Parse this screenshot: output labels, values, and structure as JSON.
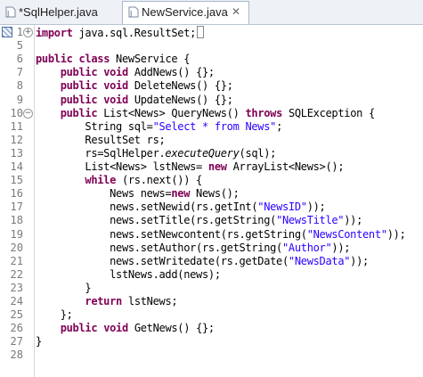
{
  "tabs": [
    {
      "label": "*SqlHelper.java",
      "active": false,
      "icon": "java-file-icon"
    },
    {
      "label": "NewService.java",
      "active": true,
      "icon": "java-file-icon",
      "close": "✕"
    }
  ],
  "colors": {
    "keyword": "#7f0055",
    "string": "#2a00ff",
    "field": "#0000c0",
    "line_number": "#7a7a7a"
  },
  "editor": {
    "lines": [
      {
        "n": "1",
        "tokens": [
          {
            "t": "import",
            "c": "kw"
          },
          {
            "t": " java.sql.ResultSet;"
          }
        ],
        "fold": "⊕"
      },
      {
        "n": "5",
        "tokens": []
      },
      {
        "n": "6",
        "tokens": [
          {
            "t": "public",
            "c": "kw"
          },
          {
            "t": " "
          },
          {
            "t": "class",
            "c": "kw"
          },
          {
            "t": " NewService {"
          }
        ]
      },
      {
        "n": "7",
        "tokens": [
          {
            "t": "    "
          },
          {
            "t": "public",
            "c": "kw"
          },
          {
            "t": " "
          },
          {
            "t": "void",
            "c": "kw"
          },
          {
            "t": " AddNews() {};"
          }
        ]
      },
      {
        "n": "8",
        "tokens": [
          {
            "t": "    "
          },
          {
            "t": "public",
            "c": "kw"
          },
          {
            "t": " "
          },
          {
            "t": "void",
            "c": "kw"
          },
          {
            "t": " DeleteNews() {};"
          }
        ]
      },
      {
        "n": "9",
        "tokens": [
          {
            "t": "    "
          },
          {
            "t": "public",
            "c": "kw"
          },
          {
            "t": " "
          },
          {
            "t": "void",
            "c": "kw"
          },
          {
            "t": " UpdateNews() {};"
          }
        ]
      },
      {
        "n": "10",
        "tokens": [
          {
            "t": "    "
          },
          {
            "t": "public",
            "c": "kw"
          },
          {
            "t": " List<News> QueryNews() "
          },
          {
            "t": "throws",
            "c": "kw"
          },
          {
            "t": " SQLException {"
          }
        ],
        "fold": "⊖"
      },
      {
        "n": "11",
        "tokens": [
          {
            "t": "        String sql="
          },
          {
            "t": "\"Select * from News\"",
            "c": "str"
          },
          {
            "t": ";"
          }
        ]
      },
      {
        "n": "12",
        "tokens": [
          {
            "t": "        ResultSet rs;"
          }
        ]
      },
      {
        "n": "13",
        "tokens": [
          {
            "t": "        rs=SqlHelper."
          },
          {
            "t": "executeQuery",
            "c": "it"
          },
          {
            "t": "(sql);"
          }
        ]
      },
      {
        "n": "14",
        "tokens": [
          {
            "t": "        List<News> lstNews= "
          },
          {
            "t": "new",
            "c": "kw"
          },
          {
            "t": " ArrayList<News>();"
          }
        ]
      },
      {
        "n": "15",
        "tokens": [
          {
            "t": "        "
          },
          {
            "t": "while",
            "c": "kw"
          },
          {
            "t": " (rs.next()) {"
          }
        ]
      },
      {
        "n": "16",
        "tokens": [
          {
            "t": "            News news="
          },
          {
            "t": "new",
            "c": "kw"
          },
          {
            "t": " News();"
          }
        ]
      },
      {
        "n": "17",
        "tokens": [
          {
            "t": "            news.setNewid(rs.getInt("
          },
          {
            "t": "\"NewsID\"",
            "c": "str"
          },
          {
            "t": "));"
          }
        ]
      },
      {
        "n": "18",
        "tokens": [
          {
            "t": "            news.setTitle(rs.getString("
          },
          {
            "t": "\"NewsTitle\"",
            "c": "str"
          },
          {
            "t": "));"
          }
        ]
      },
      {
        "n": "19",
        "tokens": [
          {
            "t": "            news.setNewcontent(rs.getString("
          },
          {
            "t": "\"NewsContent\"",
            "c": "str"
          },
          {
            "t": "));"
          }
        ]
      },
      {
        "n": "20",
        "tokens": [
          {
            "t": "            news.setAuthor(rs.getString("
          },
          {
            "t": "\"Author\"",
            "c": "str"
          },
          {
            "t": "));"
          }
        ]
      },
      {
        "n": "21",
        "tokens": [
          {
            "t": "            news.setWritedate(rs.getDate("
          },
          {
            "t": "\"NewsData\"",
            "c": "str"
          },
          {
            "t": "));"
          }
        ]
      },
      {
        "n": "22",
        "tokens": [
          {
            "t": "            lstNews.add(news);"
          }
        ]
      },
      {
        "n": "23",
        "tokens": [
          {
            "t": "        }"
          }
        ]
      },
      {
        "n": "24",
        "tokens": [
          {
            "t": "        "
          },
          {
            "t": "return",
            "c": "kw"
          },
          {
            "t": " lstNews;"
          }
        ]
      },
      {
        "n": "25",
        "tokens": [
          {
            "t": "    };"
          }
        ]
      },
      {
        "n": "26",
        "tokens": [
          {
            "t": "    "
          },
          {
            "t": "public",
            "c": "kw"
          },
          {
            "t": " "
          },
          {
            "t": "void",
            "c": "kw"
          },
          {
            "t": " GetNews() {};"
          }
        ]
      },
      {
        "n": "27",
        "tokens": [
          {
            "t": "}"
          }
        ]
      },
      {
        "n": "28",
        "tokens": []
      }
    ]
  }
}
